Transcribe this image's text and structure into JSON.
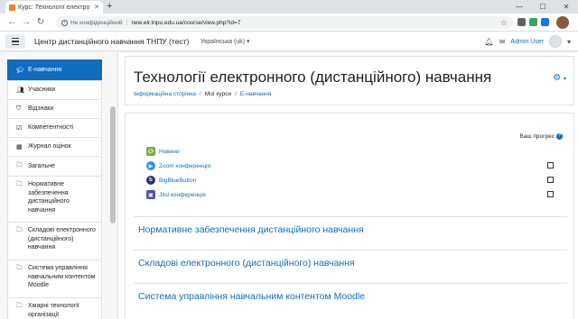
{
  "browser": {
    "tab_title": "Курс: Технології електро",
    "security_label": "Не конфіденційний",
    "url": "new.elr.tnpu.edu.ua/course/view.php?id=7"
  },
  "navbar": {
    "site_name": "Центр дистанційного навчання ТНПУ (тест)",
    "language": "Українська (uk)",
    "user_name": "Admin User"
  },
  "drawer": {
    "items": [
      {
        "label": "Е-навчання",
        "icon": "graduation-cap-icon",
        "active": true
      },
      {
        "label": "Учасники",
        "icon": "users-icon",
        "active": false
      },
      {
        "label": "Відзнаки",
        "icon": "shield-icon",
        "active": false
      },
      {
        "label": "Компетентності",
        "icon": "checkbox-icon",
        "active": false
      },
      {
        "label": "Журнал оцінок",
        "icon": "table-icon",
        "active": false
      },
      {
        "label": "Загальне",
        "icon": "folder-icon",
        "active": false
      },
      {
        "label": "Нормативне забезпечення дистанційного навчання",
        "icon": "folder-icon",
        "active": false
      },
      {
        "label": "Складові електронного (дистанційного) навчання",
        "icon": "folder-icon",
        "active": false
      },
      {
        "label": "Система управління навчальним контентом Moodle",
        "icon": "folder-icon",
        "active": false
      },
      {
        "label": "Хмарні технології організації",
        "icon": "folder-icon",
        "active": false
      }
    ]
  },
  "header": {
    "course_title": "Технології електронного (дистанційного) навчання",
    "breadcrumb": [
      "Інформаційна сторінка",
      "Мої курси",
      "Е-навчання"
    ]
  },
  "content": {
    "progress_label": "Ваш прогрес",
    "activities": [
      {
        "label": "Новини",
        "icon": "forum-icon",
        "color": "#6fb03a",
        "has_checkbox": false
      },
      {
        "label": "Zoom конференція",
        "icon": "zoom-icon",
        "color": "#2d8cff",
        "has_checkbox": true
      },
      {
        "label": "BigBlueButton",
        "icon": "bigbluebutton-icon",
        "color": "#283274",
        "has_checkbox": true
      },
      {
        "label": "Jitsi конференція",
        "icon": "jitsi-icon",
        "color": "#4a4fb3",
        "has_checkbox": true
      }
    ],
    "sections": [
      "Нормативне забезпечення дистанційного навчання",
      "Складові електронного (дистанційного) навчання",
      "Система управління навчальним контентом Moodle"
    ]
  },
  "colors": {
    "accent": "#0f6cbf"
  }
}
